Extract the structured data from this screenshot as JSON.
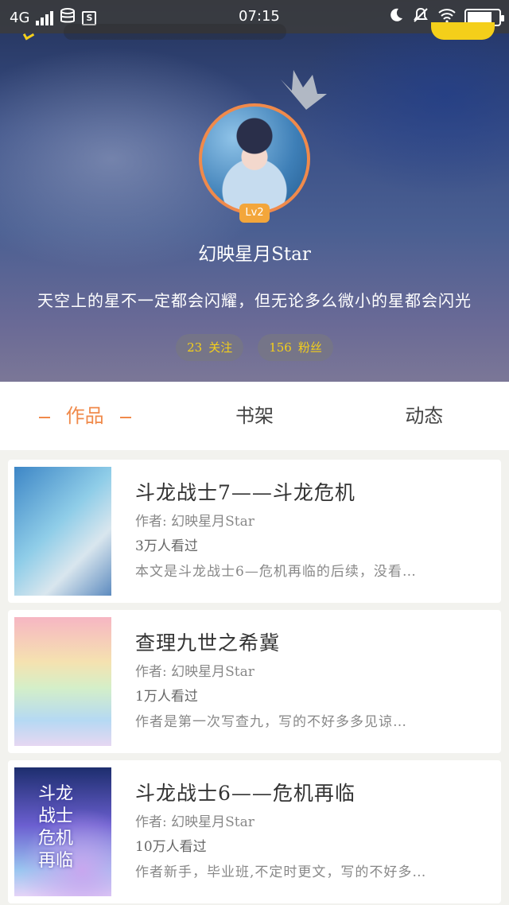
{
  "status_bar": {
    "network": "4G",
    "time": "07:15",
    "box_icon_text": "S",
    "battery_level": 0.8
  },
  "profile": {
    "level": "Lv2",
    "username": "幻映星月Star",
    "bio": "天空上的星不一定都会闪耀，但无论多么微小的星都会闪光",
    "following_count": "23",
    "following_label": "关注",
    "followers_count": "156",
    "followers_label": "粉丝"
  },
  "tabs": [
    {
      "label": "作品",
      "active": true
    },
    {
      "label": "书架",
      "active": false
    },
    {
      "label": "动态",
      "active": false
    }
  ],
  "books": [
    {
      "title": "斗龙战士7——斗龙危机",
      "author": "作者: 幻映星月Star",
      "views": "3万人看过",
      "description": "本文是斗龙战士6—危机再临的后续，没看…"
    },
    {
      "title": "查理九世之希冀",
      "author": "作者: 幻映星月Star",
      "views": "1万人看过",
      "description": "作者是第一次写查九，写的不好多多见谅…"
    },
    {
      "title": "斗龙战士6——危机再临",
      "author": "作者: 幻映星月Star",
      "views": "10万人看过",
      "description": "作者新手，毕业班,不定时更文，写的不好多…",
      "cover_text": "斗龙战士危机再临"
    }
  ],
  "colors": {
    "accent": "#f08a4b",
    "badge": "#f3a63b",
    "stat_text": "#f4cf1a"
  }
}
